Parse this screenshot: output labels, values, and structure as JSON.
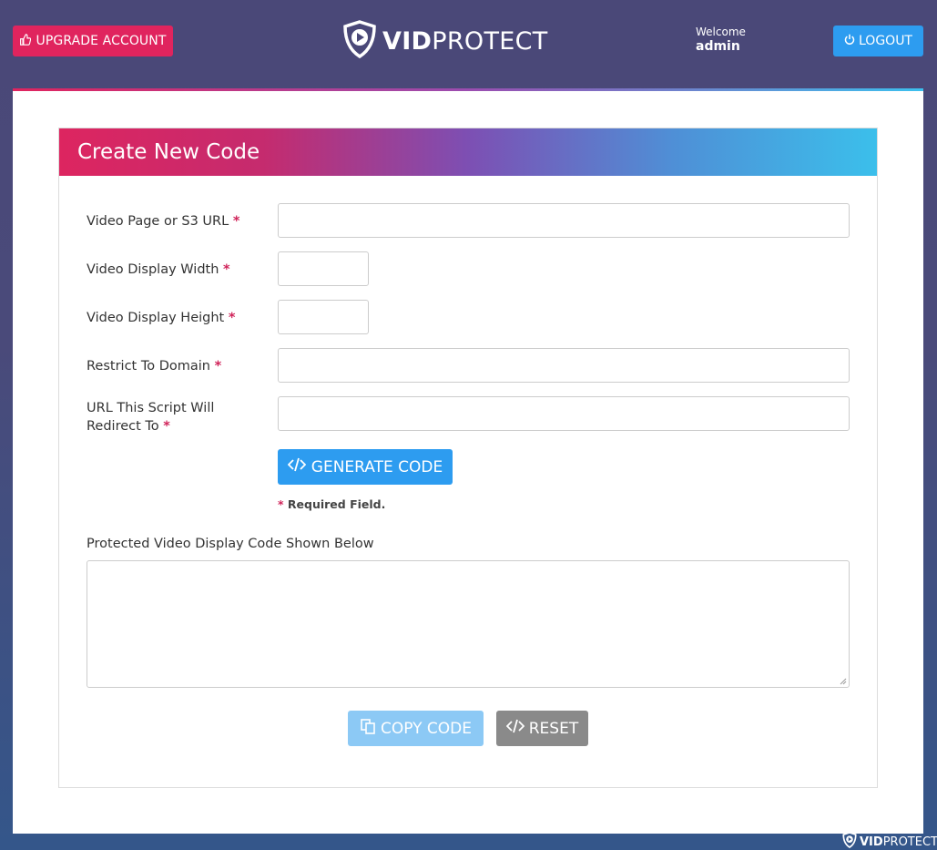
{
  "header": {
    "upgrade_label": "UPGRADE ACCOUNT",
    "logo_bold": "VID",
    "logo_light": "PROTECT",
    "welcome_label": "Welcome",
    "username": "admin",
    "logout_label": "LOGOUT"
  },
  "panel": {
    "title": "Create New Code"
  },
  "form": {
    "required_mark": "*",
    "fields": [
      {
        "label": "Video Page or S3 URL",
        "value": ""
      },
      {
        "label": "Video Display Width",
        "value": ""
      },
      {
        "label": "Video Display Height",
        "value": ""
      },
      {
        "label": "Restrict To Domain",
        "value": ""
      },
      {
        "label": "URL This Script Will Redirect To",
        "value": ""
      }
    ],
    "generate_label": "GENERATE CODE",
    "required_note": "Required Field.",
    "output_label": "Protected Video Display Code Shown Below",
    "output_value": ""
  },
  "actions": {
    "copy_label": "COPY CODE",
    "reset_label": "RESET"
  },
  "footer": {
    "logo_bold": "VID",
    "logo_light": "PROTECT"
  },
  "colors": {
    "accent_pink": "#e0245e",
    "accent_blue": "#2d9cf0",
    "copy_button": "#8cc9f5",
    "reset_button": "#8a8a8a"
  }
}
